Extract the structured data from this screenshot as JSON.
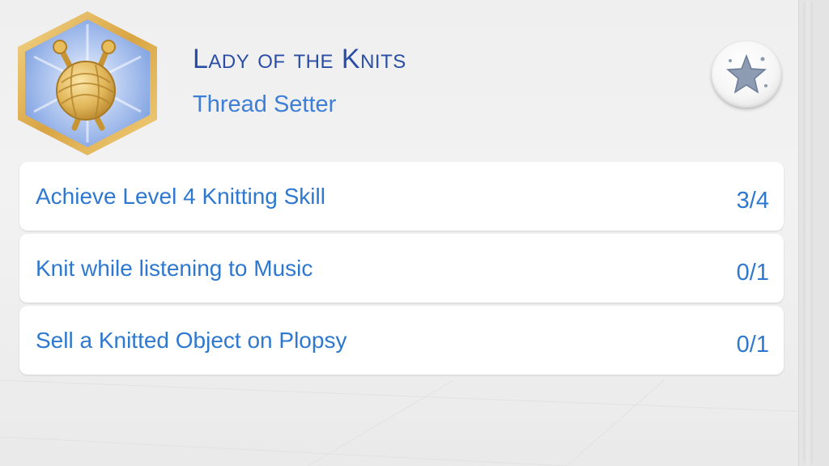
{
  "aspiration": {
    "title": "Lady of the Knits",
    "subtitle": "Thread Setter",
    "badge_icon": "yarn-ball-knitting-needles-icon",
    "action_icon": "star-icon"
  },
  "goals": [
    {
      "label": "Achieve Level 4 Knitting Skill",
      "progress": "3/4"
    },
    {
      "label": "Knit while listening to Music",
      "progress": "0/1"
    },
    {
      "label": "Sell a Knitted Object on Plopsy",
      "progress": "0/1"
    }
  ],
  "colors": {
    "title": "#2a4da6",
    "text_accent": "#2e78d0",
    "badge_frame": "#e3b34f",
    "badge_fill": "#8fb0e8",
    "yarn": "#e0b65a"
  }
}
